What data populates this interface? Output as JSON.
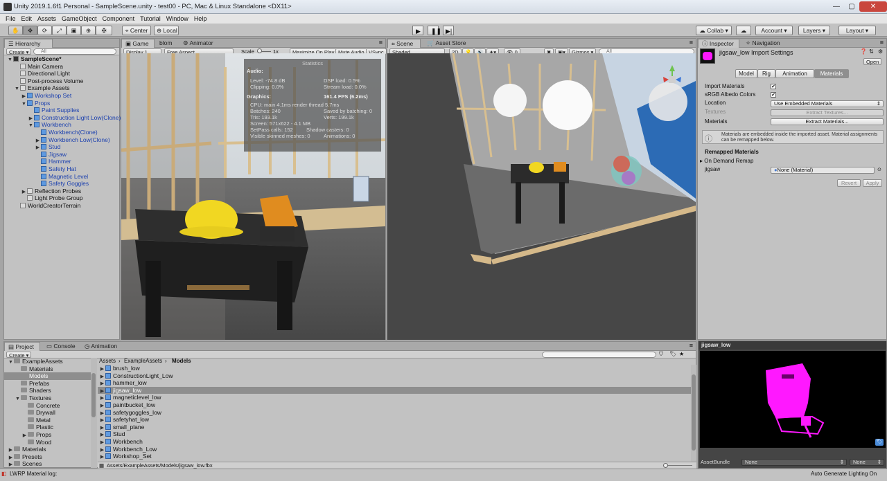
{
  "window": {
    "title": "Unity 2019.1.6f1 Personal - SampleScene.unity - test00 - PC, Mac & Linux Standalone <DX11>",
    "minimize": "—",
    "maximize": "▢",
    "close": "✕"
  },
  "menu": [
    "File",
    "Edit",
    "Assets",
    "GameObject",
    "Component",
    "Tutorial",
    "Window",
    "Help"
  ],
  "toolbar": {
    "pivot": "Center",
    "space": "Local",
    "collab": "Collab ▾",
    "account": "Account ▾",
    "layers": "Layers ▾",
    "layout": "Layout ▾"
  },
  "hierarchy": {
    "tab": "Hierarchy",
    "create": "Create ▾",
    "search_placeholder": "All",
    "items": [
      {
        "label": "SampleScene*",
        "depth": 0
      },
      {
        "label": "Main Camera",
        "depth": 1
      },
      {
        "label": "Directional Light",
        "depth": 1
      },
      {
        "label": "Post-process Volume",
        "depth": 1
      },
      {
        "label": "Example Assets",
        "depth": 1
      },
      {
        "label": "Workshop Set",
        "depth": 2
      },
      {
        "label": "Props",
        "depth": 2
      },
      {
        "label": "Paint Supplies",
        "depth": 3
      },
      {
        "label": "Construction Light Low(Clone)",
        "depth": 3
      },
      {
        "label": "Workbench",
        "depth": 3
      },
      {
        "label": "Workbench(Clone)",
        "depth": 4
      },
      {
        "label": "Workbench Low(Clone)",
        "depth": 4
      },
      {
        "label": "Stud",
        "depth": 4
      },
      {
        "label": "Jigsaw",
        "depth": 4
      },
      {
        "label": "Hammer",
        "depth": 4
      },
      {
        "label": "Safety Hat",
        "depth": 4
      },
      {
        "label": "Magnetic Level",
        "depth": 4
      },
      {
        "label": "Safety Goggles",
        "depth": 4
      },
      {
        "label": "Reflection Probes",
        "depth": 2
      },
      {
        "label": "Light Probe Group",
        "depth": 2
      },
      {
        "label": "WorldCreatorTerrain",
        "depth": 1
      }
    ]
  },
  "game": {
    "tabs": [
      "Game",
      "blom",
      "Animator"
    ],
    "display": "Display 1",
    "aspect": "Free Aspect",
    "scale_label": "Scale",
    "scale_value": "1x",
    "maximize": "Maximize On Play",
    "mute": "Mute Audio",
    "vsync": "VSync"
  },
  "stats": {
    "title": "Statistics",
    "audio_header": "Audio:",
    "level": "Level: -74.8 dB",
    "clipping": "Clipping: 0.0%",
    "dsp": "DSP load: 0.5%",
    "stream": "Stream load: 0.0%",
    "graphics_header": "Graphics:",
    "fps": "161.4 FPS (6.2ms)",
    "cpu": "CPU: main 4.1ms  render thread 5.7ms",
    "batches": "Batches: 240",
    "saved": "Saved by batching: 0",
    "tris": "Tris: 193.1k",
    "verts": "Verts: 199.1k",
    "screen": "Screen: 571x622 - 4.1 MB",
    "setpass": "SetPass calls: 152",
    "shadow": "Shadow casters: 0",
    "skinned": "Visible skinned meshes: 0",
    "animations": "Animations: 0"
  },
  "scene": {
    "tabs": [
      "Scene",
      "Asset Store"
    ],
    "shading": "Shaded",
    "mode2d": "2D",
    "fx_count": "0",
    "gizmos": "Gizmos ▾",
    "search_placeholder": "All"
  },
  "inspector": {
    "tabs": [
      "Inspector",
      "Navigation"
    ],
    "title": "jigsaw_low Import Settings",
    "open": "Open",
    "subtabs": [
      "Model",
      "Rig",
      "Animation",
      "Materials"
    ],
    "import_materials": "Import Materials",
    "srgb": "sRGB Albedo Colors",
    "location_label": "Location",
    "location_value": "Use Embedded Materials",
    "textures_label": "Textures",
    "extract_textures": "Extract Textures...",
    "materials_label": "Materials",
    "extract_materials": "Extract Materials...",
    "help_text": "Materials are embedded inside the imported asset. Material assignments can be remapped below.",
    "remapped_header": "Remapped Materials",
    "on_demand": "On Demand Remap",
    "jigsaw_label": "jigsaw",
    "jigsaw_value": "None (Material)",
    "revert": "Revert",
    "apply": "Apply"
  },
  "project": {
    "tabs": [
      "Project",
      "Console",
      "Animation"
    ],
    "create": "Create ▾",
    "tree": [
      {
        "label": "ExampleAssets",
        "depth": 0
      },
      {
        "label": "Materials",
        "depth": 1
      },
      {
        "label": "Models",
        "depth": 1
      },
      {
        "label": "Prefabs",
        "depth": 1
      },
      {
        "label": "Shaders",
        "depth": 1
      },
      {
        "label": "Textures",
        "depth": 1
      },
      {
        "label": "Concrete",
        "depth": 2
      },
      {
        "label": "Drywall",
        "depth": 2
      },
      {
        "label": "Metal",
        "depth": 2
      },
      {
        "label": "Plastic",
        "depth": 2
      },
      {
        "label": "Props",
        "depth": 2
      },
      {
        "label": "Wood",
        "depth": 2
      },
      {
        "label": "Materials",
        "depth": 0
      },
      {
        "label": "Presets",
        "depth": 0
      },
      {
        "label": "Scenes",
        "depth": 0
      }
    ],
    "breadcrumb": [
      "Assets",
      "ExampleAssets",
      "Models"
    ],
    "files": [
      "brush_low",
      "ConstructionLight_Low",
      "hammer_low",
      "jigsaw_low",
      "magneticlevel_low",
      "paintbucket_low",
      "safetygoggles_low",
      "safetyhat_low",
      "small_plane",
      "Stud",
      "Workbench",
      "Workbench_Low",
      "Workshop_Set"
    ],
    "path": "Assets/ExampleAssets/Models/jigsaw_low.fbx"
  },
  "preview": {
    "title": "jigsaw_low",
    "asset_bundle": "AssetBundle",
    "bundle_value": "None",
    "variant_value": "None"
  },
  "status": {
    "left": "LWRP Material log:",
    "right": "Auto Generate Lighting On"
  }
}
